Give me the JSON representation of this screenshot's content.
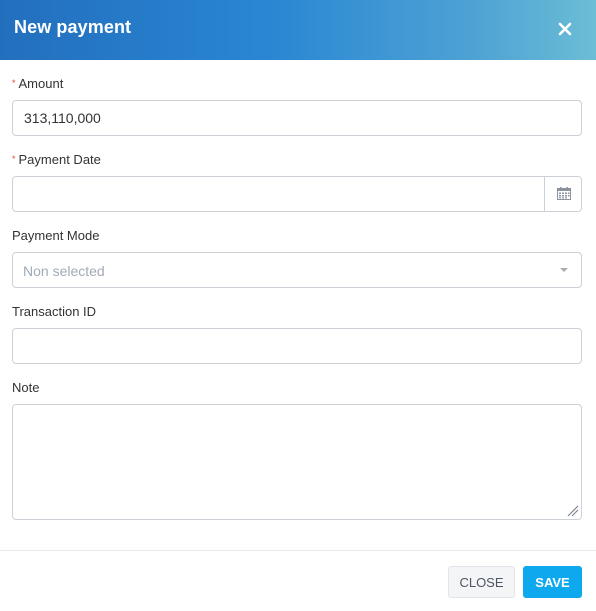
{
  "modal": {
    "title": "New payment",
    "close_icon": "close-icon"
  },
  "form": {
    "amount": {
      "label": "Amount",
      "required_mark": "*",
      "value": "313,110,000"
    },
    "payment_date": {
      "label": "Payment Date",
      "required_mark": "*",
      "value": "",
      "icon": "calendar-icon"
    },
    "payment_mode": {
      "label": "Payment Mode",
      "selected": "Non selected",
      "icon": "caret-down-icon"
    },
    "transaction_id": {
      "label": "Transaction ID",
      "value": ""
    },
    "note": {
      "label": "Note",
      "value": ""
    }
  },
  "footer": {
    "close_label": "CLOSE",
    "save_label": "SAVE"
  },
  "colors": {
    "header_gradient_start": "#226fbe",
    "header_gradient_end": "#6cbdd6",
    "required": "#e4442d",
    "save_button": "#0ea8ef",
    "placeholder": "#a2aab5"
  }
}
